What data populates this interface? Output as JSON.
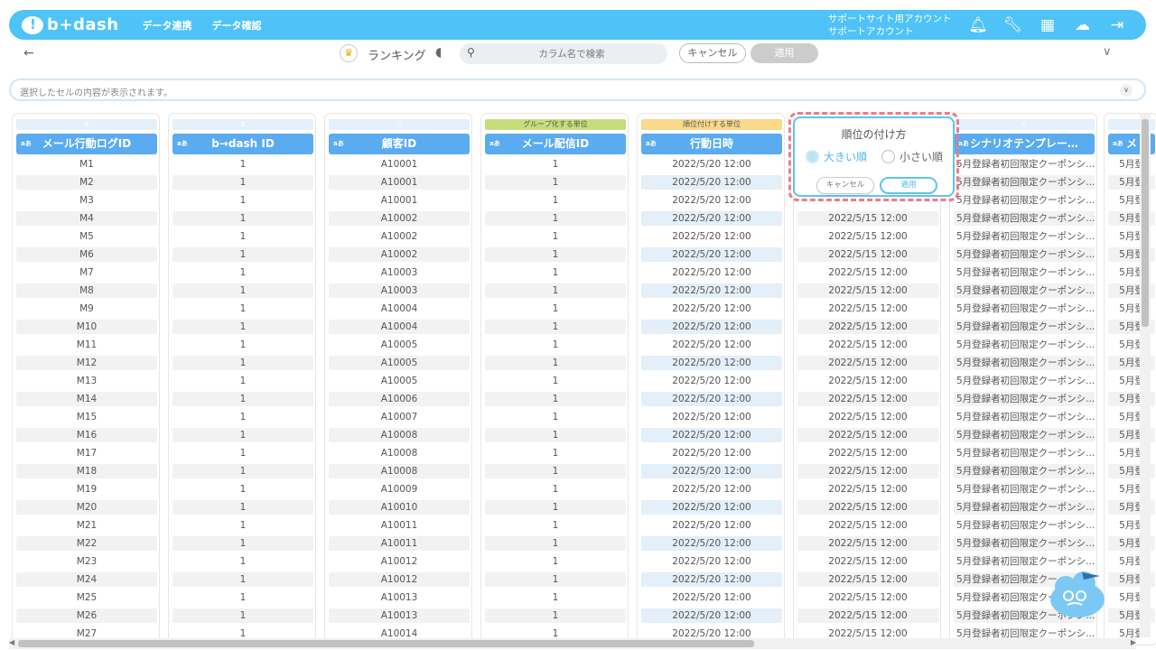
{
  "app": {
    "logo_text": "b+dash"
  },
  "nav": {
    "items": [
      "データ連携",
      "データ確認"
    ]
  },
  "account": {
    "line1": "サポートサイト用アカウント",
    "line2": "サポートアカウント"
  },
  "icons": [
    "bell-icon",
    "wrench-icon",
    "grid-icon",
    "chat-icon",
    "logout-icon"
  ],
  "toolbar": {
    "title": "ランキング",
    "search_placeholder": "カラム名で検索",
    "cancel_label": "キャンセル",
    "apply_label": "適用"
  },
  "cell_content": {
    "placeholder": "選択したセルの内容が表示されます。"
  },
  "type_badge": "aあ",
  "columns": [
    {
      "letter": "A",
      "tag": "",
      "header": "メール行動ログID",
      "values": [
        "M1",
        "M2",
        "M3",
        "M4",
        "M5",
        "M6",
        "M7",
        "M8",
        "M9",
        "M10",
        "M11",
        "M12",
        "M13",
        "M14",
        "M15",
        "M16",
        "M17",
        "M18",
        "M19",
        "M20",
        "M21",
        "M22",
        "M23",
        "M24",
        "M25",
        "M26",
        "M27"
      ]
    },
    {
      "letter": "B",
      "tag": "",
      "header": "b→dash ID",
      "values": [
        "1",
        "1",
        "1",
        "1",
        "1",
        "1",
        "1",
        "1",
        "1",
        "1",
        "1",
        "1",
        "1",
        "1",
        "1",
        "1",
        "1",
        "1",
        "1",
        "1",
        "1",
        "1",
        "1",
        "1",
        "1",
        "1",
        "1"
      ]
    },
    {
      "letter": "C",
      "tag": "",
      "header": "顧客ID",
      "values": [
        "A10001",
        "A10001",
        "A10001",
        "A10002",
        "A10002",
        "A10002",
        "A10003",
        "A10003",
        "A10004",
        "A10004",
        "A10005",
        "A10005",
        "A10005",
        "A10006",
        "A10007",
        "A10008",
        "A10008",
        "A10008",
        "A10009",
        "A10010",
        "A10011",
        "A10011",
        "A10012",
        "A10012",
        "A10013",
        "A10013",
        "A10014"
      ]
    },
    {
      "letter": "",
      "tag": "グループ化する単位",
      "header": "メール配信ID",
      "values": [
        "1",
        "1",
        "1",
        "1",
        "1",
        "1",
        "1",
        "1",
        "1",
        "1",
        "1",
        "1",
        "1",
        "1",
        "1",
        "1",
        "1",
        "1",
        "1",
        "1",
        "1",
        "1",
        "1",
        "1",
        "1",
        "1",
        "1"
      ]
    },
    {
      "letter": "",
      "tag": "順位付けする単位",
      "header": "行動日時",
      "values": [
        "2022/5/20 12:00",
        "2022/5/20 12:00",
        "2022/5/20 12:00",
        "2022/5/20 12:00",
        "2022/5/20 12:00",
        "2022/5/20 12:00",
        "2022/5/20 12:00",
        "2022/5/20 12:00",
        "2022/5/20 12:00",
        "2022/5/20 12:00",
        "2022/5/20 12:00",
        "2022/5/20 12:00",
        "2022/5/20 12:00",
        "2022/5/20 12:00",
        "2022/5/20 12:00",
        "2022/5/20 12:00",
        "2022/5/20 12:00",
        "2022/5/20 12:00",
        "2022/5/20 12:00",
        "2022/5/20 12:00",
        "2022/5/20 12:00",
        "2022/5/20 12:00",
        "2022/5/20 12:00",
        "2022/5/20 12:00",
        "2022/5/20 12:00",
        "2022/5/20 12:00",
        "2022/5/20 12:00"
      ]
    },
    {
      "letter": "",
      "tag": "",
      "header": "",
      "values": [
        "",
        "",
        "",
        "2022/5/15 12:00",
        "2022/5/15 12:00",
        "2022/5/15 12:00",
        "2022/5/15 12:00",
        "2022/5/15 12:00",
        "2022/5/15 12:00",
        "2022/5/15 12:00",
        "2022/5/15 12:00",
        "2022/5/15 12:00",
        "2022/5/15 12:00",
        "2022/5/15 12:00",
        "2022/5/15 12:00",
        "2022/5/15 12:00",
        "2022/5/15 12:00",
        "2022/5/15 12:00",
        "2022/5/15 12:00",
        "2022/5/15 12:00",
        "2022/5/15 12:00",
        "2022/5/15 12:00",
        "2022/5/15 12:00",
        "2022/5/15 12:00",
        "2022/5/15 12:00",
        "2022/5/15 12:00",
        "2022/5/15 12:00"
      ]
    },
    {
      "letter": "G",
      "tag": "",
      "header": "シナリオテンプレー…",
      "values": [
        "5月登録者初回限定クーポンシ...",
        "5月登録者初回限定クーポンシ...",
        "5月登録者初回限定クーポンシ...",
        "5月登録者初回限定クーポンシ...",
        "5月登録者初回限定クーポンシ...",
        "5月登録者初回限定クーポンシ...",
        "5月登録者初回限定クーポンシ...",
        "5月登録者初回限定クーポンシ...",
        "5月登録者初回限定クーポンシ...",
        "5月登録者初回限定クーポンシ...",
        "5月登録者初回限定クーポンシ...",
        "5月登録者初回限定クーポンシ...",
        "5月登録者初回限定クーポンシ...",
        "5月登録者初回限定クーポンシ...",
        "5月登録者初回限定クーポンシ...",
        "5月登録者初回限定クーポンシ...",
        "5月登録者初回限定クーポンシ...",
        "5月登録者初回限定クーポンシ...",
        "5月登録者初回限定クーポンシ...",
        "5月登録者初回限定クーポンシ...",
        "5月登録者初回限定クーポンシ...",
        "5月登録者初回限定クーポンシ...",
        "5月登録者初回限定クーポンシ...",
        "5月登録者初回限定クー",
        "5月登録者初回限定クー",
        "5月登録者初回限定クーポンシ...",
        "5月登録者初回限定クーポンシ..."
      ]
    },
    {
      "letter": "",
      "tag": "",
      "header": "メ",
      "values": [
        "5月登",
        "5月登",
        "5月登",
        "5月登",
        "5月登",
        "5月登",
        "5月登",
        "5月登",
        "5月登",
        "5月登",
        "5月登",
        "5月登",
        "5月登",
        "5月登",
        "5月登",
        "5月登",
        "5月登",
        "5月登",
        "5月登",
        "5月登",
        "5月登",
        "5月登",
        "5月登",
        "5月登",
        "5月登",
        "5月登",
        "5月登"
      ]
    }
  ],
  "ranking_popup": {
    "title": "順位の付け方",
    "option_desc": "大きい順",
    "option_asc": "小さい順",
    "selected": "desc",
    "cancel_label": "キャンセル",
    "apply_label": "適用"
  },
  "colors": {
    "accent": "#4fc3f7",
    "header": "#5aabf0",
    "group_tag": "#c7dd7c",
    "order_tag": "#fbd98a",
    "highlight": "#ef7c86"
  }
}
